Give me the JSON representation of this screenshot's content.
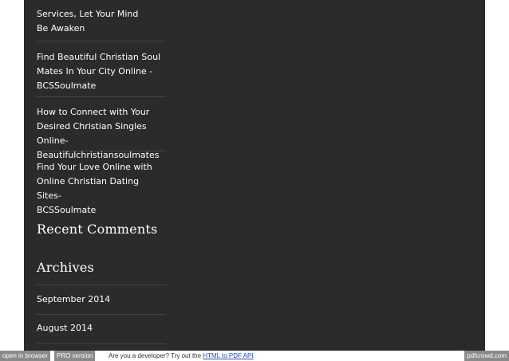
{
  "sidebar": {
    "posts": [
      {
        "label": "Services, Let Your Mind\nBe Awaken"
      },
      {
        "label": "Find Beautiful Christian Soul\nMates In Your City Online -\nBCSSoulmate"
      },
      {
        "label": "How to Connect with Your\nDesired Christian Singles Online-\nBeautifulchristiansoulmates"
      },
      {
        "label": "Find Your Love Online with\nOnline Christian Dating Sites-\nBCSSoulmate"
      }
    ],
    "recent_comments_title": "Recent Comments",
    "archives_title": "Archives",
    "archives": [
      {
        "label": "September 2014"
      },
      {
        "label": "August 2014"
      }
    ]
  },
  "footer": {
    "open_in_browser": "open in browser",
    "pro_version": "PRO version",
    "developer_text": "Are you a developer? Try out the ",
    "api_link": "HTML to PDF API",
    "brand": "pdfcrowd.com"
  },
  "colors": {
    "panel_bg": "#2b2b2b",
    "footer_button_bg": "#8a8a8a",
    "link_blue": "#1a4fcc"
  }
}
